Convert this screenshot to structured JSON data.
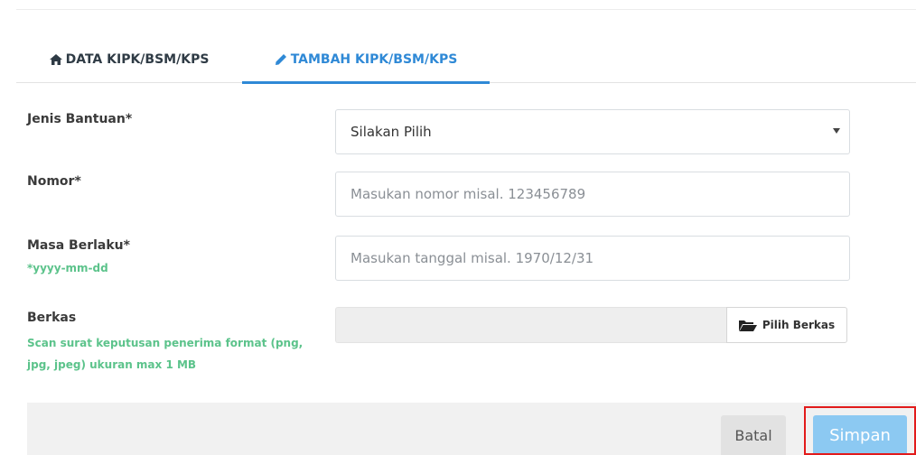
{
  "tabs": {
    "data_label": "DATA KIPK/BSM/KPS",
    "tambah_label": "TAMBAH KIPK/BSM/KPS",
    "active": "TAMBAH KIPK/BSM/KPS"
  },
  "form": {
    "jenis": {
      "label": "Jenis Bantuan*",
      "selected": "Silakan Pilih"
    },
    "nomor": {
      "label": "Nomor*",
      "placeholder": "Masukan nomor misal. 123456789"
    },
    "masa": {
      "label": "Masa Berlaku*",
      "hint": "*yyyy-mm-dd",
      "placeholder": "Masukan tanggal misal. 1970/12/31"
    },
    "berkas": {
      "label": "Berkas",
      "hint_line1": "Scan surat keputusan penerima format (png,",
      "hint_line2": "jpg, jpeg) ukuran max 1 MB",
      "button": "Pilih Berkas"
    }
  },
  "footer": {
    "cancel": "Batal",
    "save": "Simpan"
  },
  "colors": {
    "accent": "#2f89d6",
    "hint": "#5cc38b",
    "save_bg": "#8cc9f2",
    "highlight": "#e21b1b"
  },
  "icons": {
    "data_tab": "home-icon",
    "tambah_tab": "pencil-icon",
    "file_button": "folder-open-icon"
  }
}
